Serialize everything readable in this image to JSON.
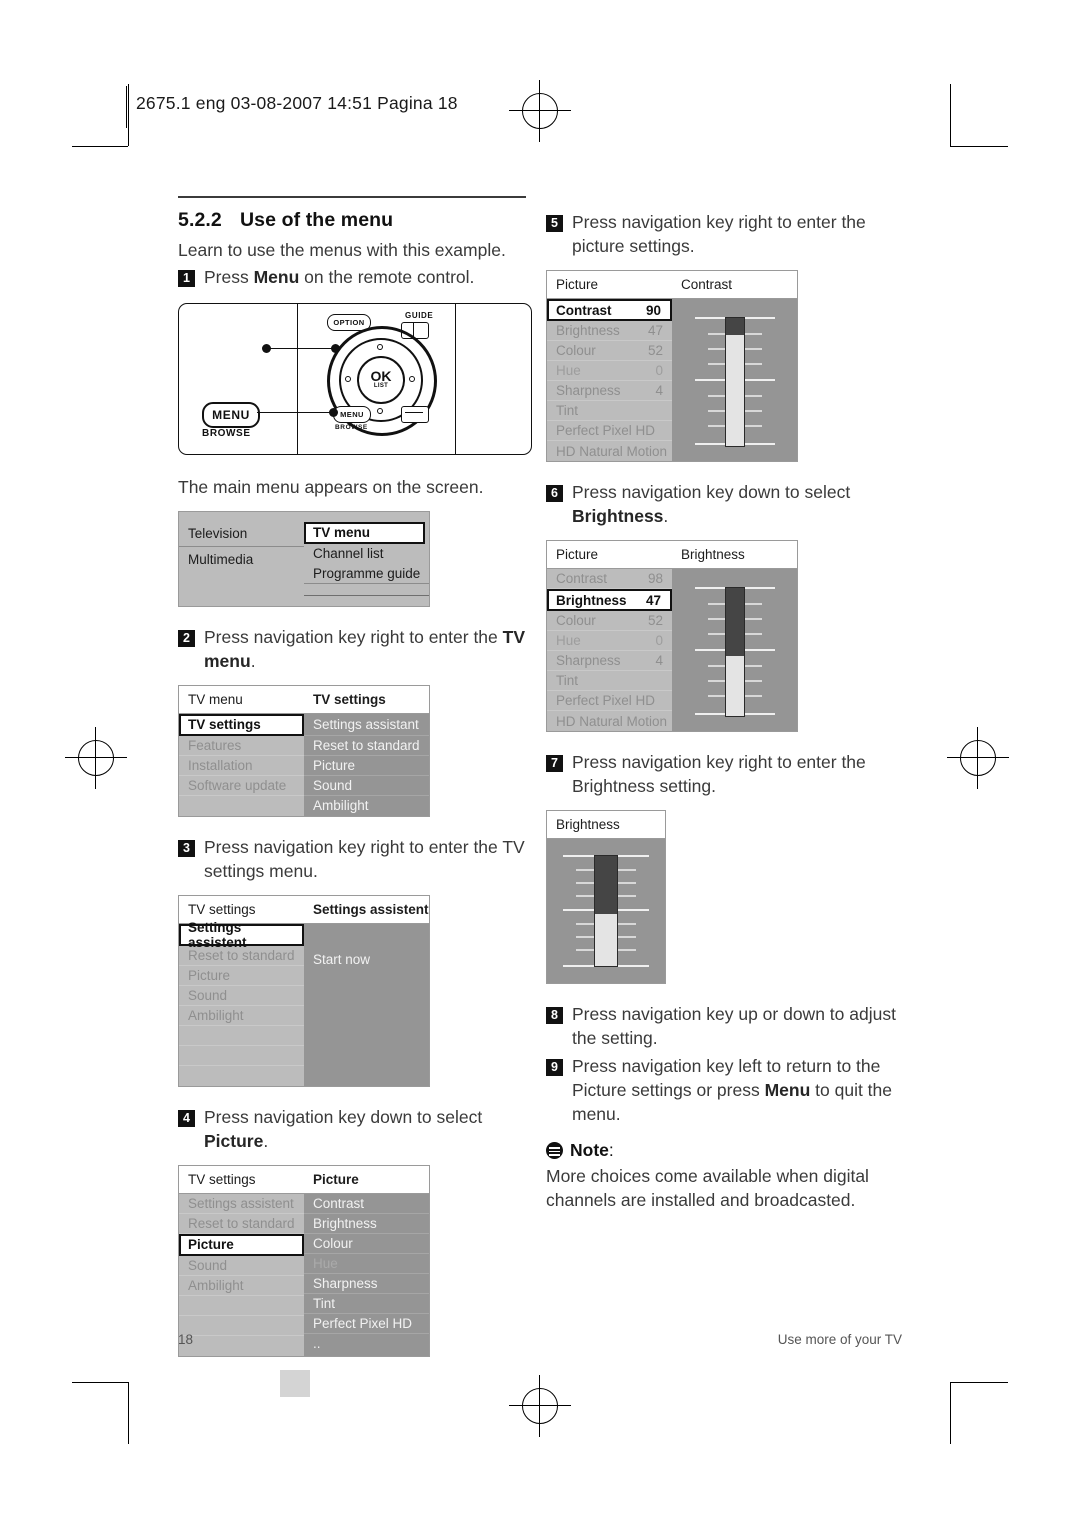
{
  "header": {
    "meta": "2675.1 eng   03-08-2007   14:51   Pagina 18"
  },
  "section": {
    "number": "5.2.2",
    "title": "Use of the menu",
    "intro": "Learn to use the menus with this example."
  },
  "steps": [
    {
      "num": "1",
      "text_before": "Press ",
      "bold": "Menu",
      "text_after": " on the remote control."
    },
    {
      "num": "2",
      "text_before": "Press navigation key right to enter the ",
      "bold": "TV menu",
      "text_after": "."
    },
    {
      "num": "3",
      "text_before": "Press navigation key right to enter the TV settings menu.",
      "bold": "",
      "text_after": ""
    },
    {
      "num": "4",
      "text_before": "Press navigation key down to select ",
      "bold": "Picture",
      "text_after": "."
    },
    {
      "num": "5",
      "text_before": "Press navigation key right to enter the picture settings.",
      "bold": "",
      "text_after": ""
    },
    {
      "num": "6",
      "text_before": "Press navigation key down to select ",
      "bold": "Brightness",
      "text_after": "."
    },
    {
      "num": "7",
      "text_before": "Press navigation key right to enter the Brightness setting.",
      "bold": "",
      "text_after": ""
    },
    {
      "num": "8",
      "text_before": "Press navigation key up or down to adjust the setting.",
      "bold": "",
      "text_after": ""
    },
    {
      "num": "9",
      "text_before": "Press navigation key left to return to the Picture settings or press ",
      "bold": "Menu",
      "text_after": " to quit the menu."
    }
  ],
  "caption_main_menu": "The main menu appears on the screen.",
  "remote": {
    "option_label": "OPTION",
    "guide_label": "GUIDE",
    "ok_label": "OK",
    "list_label": "LIST",
    "menu_button": "MENU",
    "browse_label": "BROWSE",
    "menu_small": "MENU",
    "browse_small": "BROWSE"
  },
  "menus": {
    "main": {
      "head_left": "Television",
      "head_right": "",
      "left_items": [
        "Television",
        "Multimedia"
      ],
      "right_items": [
        "TV menu",
        "Channel list",
        "Programme guide"
      ],
      "selected_right": "TV menu"
    },
    "step2": {
      "head_left": "TV menu",
      "head_right": "TV settings",
      "left_items": [
        "TV settings",
        "Features",
        "Installation",
        "Software update"
      ],
      "right_items": [
        "Settings assistant",
        "Reset to standard",
        "Picture",
        "Sound",
        "Ambilight"
      ],
      "selected_left": "TV settings"
    },
    "step3": {
      "head_left": "TV settings",
      "head_right": "Settings assistent",
      "left_items": [
        "Settings assistent",
        "Reset to standard",
        "Picture",
        "Sound",
        "Ambilight"
      ],
      "right_items": [
        "Start now"
      ],
      "selected_left": "Settings assistent"
    },
    "step4": {
      "head_left": "TV settings",
      "head_right": "Picture",
      "left_items": [
        "Settings assistent",
        "Reset to standard",
        "Picture",
        "Sound",
        "Ambilight"
      ],
      "right_items": [
        "Contrast",
        "Brightness",
        "Colour",
        "Hue",
        "Sharpness",
        "Tint",
        "Perfect Pixel HD",
        ".."
      ],
      "right_dim": [
        "Hue"
      ],
      "selected_left": "Picture"
    },
    "step5": {
      "head_left": "Picture",
      "head_right": "Contrast",
      "rows": [
        {
          "label": "Contrast",
          "value": "90"
        },
        {
          "label": "Brightness",
          "value": "47"
        },
        {
          "label": "Colour",
          "value": "52"
        },
        {
          "label": "Hue",
          "value": "0"
        },
        {
          "label": "Sharpness",
          "value": "4"
        },
        {
          "label": "Tint",
          "value": ""
        },
        {
          "label": "Perfect Pixel HD",
          "value": ""
        },
        {
          "label": "HD Natural Motion",
          "value": ""
        }
      ],
      "selected": "Contrast",
      "dim": [
        "Hue"
      ],
      "slider_percent": 90
    },
    "step6": {
      "head_left": "Picture",
      "head_right": "Brightness",
      "rows": [
        {
          "label": "Contrast",
          "value": "98"
        },
        {
          "label": "Brightness",
          "value": "47"
        },
        {
          "label": "Colour",
          "value": "52"
        },
        {
          "label": "Hue",
          "value": "0"
        },
        {
          "label": "Sharpness",
          "value": "4"
        },
        {
          "label": "Tint",
          "value": ""
        },
        {
          "label": "Perfect Pixel HD",
          "value": ""
        },
        {
          "label": "HD Natural Motion",
          "value": ""
        }
      ],
      "selected": "Brightness",
      "dim": [
        "Hue"
      ],
      "slider_percent": 47
    },
    "step7": {
      "title": "Brightness",
      "slider_percent": 47
    }
  },
  "note": {
    "label": "Note",
    "colon": ":",
    "text": "More choices come available when digital channels are installed and broadcasted."
  },
  "footer": {
    "page_number": "18",
    "section_name": "Use more of your TV"
  }
}
